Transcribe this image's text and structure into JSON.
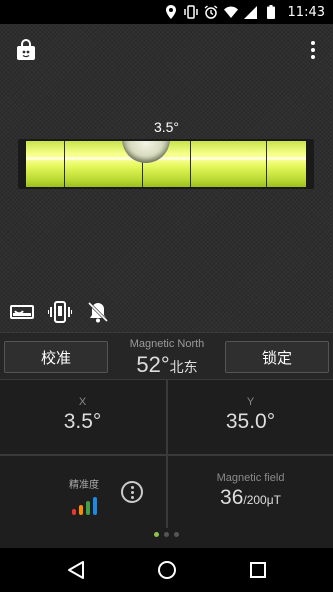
{
  "status_bar": {
    "time": "11:43",
    "icons": [
      "location-icon",
      "vibrate-icon",
      "alarm-icon",
      "wifi-icon",
      "signal-icon",
      "battery-icon"
    ]
  },
  "level": {
    "angle": "3.5°",
    "accent_color": "#e4f85a"
  },
  "panel": {
    "calibrate_label": "校准",
    "lock_label": "锁定",
    "north_label": "Magnetic North",
    "north_value": "52°",
    "north_unit": "北东",
    "x_label": "X",
    "x_value": "3.5°",
    "y_label": "Y",
    "y_value": "35.0°",
    "accuracy_label": "精准度",
    "accuracy_colors": [
      "#e53935",
      "#fb8c00",
      "#43a047",
      "#1e88e5"
    ],
    "field_label": "Magnetic field",
    "field_value": "36",
    "field_unit": "/200μT"
  },
  "pager": {
    "active_index": 0,
    "count": 3
  },
  "nav": [
    "back-icon",
    "home-icon",
    "recents-icon"
  ]
}
